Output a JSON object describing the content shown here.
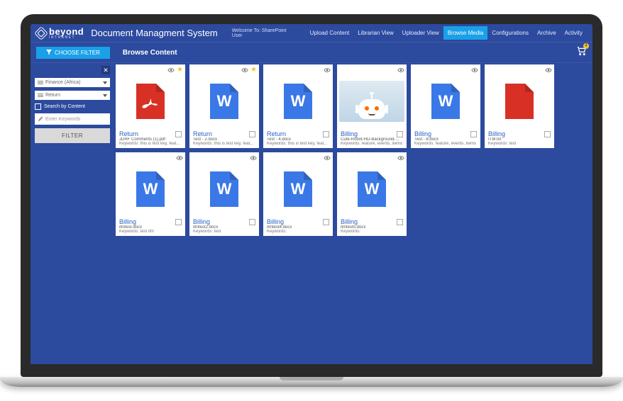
{
  "brand": {
    "name": "beyond",
    "tagline": "INTRANET"
  },
  "app_title": "Document Managment System",
  "welcome": "Welcome To: SharePoint User",
  "nav": [
    {
      "label": "Upload Content",
      "active": false
    },
    {
      "label": "Librarian View",
      "active": false
    },
    {
      "label": "Uploader View",
      "active": false
    },
    {
      "label": "Browse Media",
      "active": true
    },
    {
      "label": "Configurations",
      "active": false
    },
    {
      "label": "Archive",
      "active": false
    },
    {
      "label": "Activity",
      "active": false
    }
  ],
  "choose_filter_label": "CHOOSE FILTER",
  "page_title": "Browse Content",
  "cart_count": "4",
  "sidebar": {
    "select1": "Finance (Africa)",
    "select2": "Return",
    "search_by_content": "Search by Content",
    "keyword_placeholder": "Enter Keywords",
    "filter_btn": "FILTER"
  },
  "cards": [
    {
      "type": "pdf",
      "star": true,
      "title": "Return",
      "file": "JDRF Comments (1).pdf",
      "keywords": "Keywords: this is test key, feat..."
    },
    {
      "type": "word",
      "star": true,
      "title": "Return",
      "file": "Test - 2.docx",
      "keywords": "Keywords: this is test key, feat..."
    },
    {
      "type": "word",
      "star": false,
      "title": "Return",
      "file": "Test - 4.docx",
      "keywords": "Keywords: this is test key, feat..."
    },
    {
      "type": "image",
      "star": false,
      "title": "Billing",
      "file": "Cute-Robot-HD-Background-...",
      "keywords": "Keywords: feature, events, items"
    },
    {
      "type": "word",
      "star": false,
      "title": "Billing",
      "file": "Test - 8.docx",
      "keywords": "Keywords: feature, events, items"
    },
    {
      "type": "txt",
      "star": false,
      "title": "Billing",
      "file": "ITM.txt",
      "keywords": "Keywords: test"
    },
    {
      "type": "word",
      "star": false,
      "title": "Billing",
      "file": "itmtest.docx",
      "keywords": "Keywords: test itm"
    },
    {
      "type": "word",
      "star": false,
      "title": "Billing",
      "file": "itmtest2.docx",
      "keywords": "Keywords: test"
    },
    {
      "type": "word",
      "star": false,
      "title": "Billing",
      "file": "itmtest4.docx",
      "keywords": "Keywords:"
    },
    {
      "type": "word",
      "star": false,
      "title": "Billing",
      "file": "itmtest5.docx",
      "keywords": "Keywords:"
    }
  ]
}
